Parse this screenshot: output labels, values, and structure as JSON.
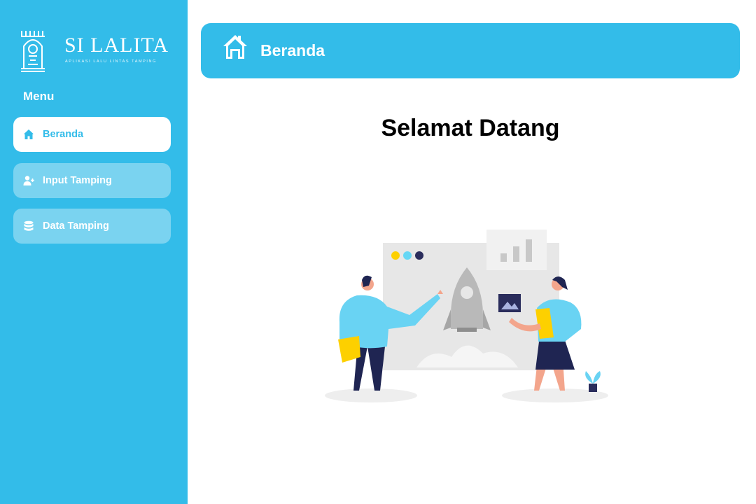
{
  "brand": {
    "name": "SI LALITA",
    "tagline": "APLIKASI LALU LINTAS TAMPING",
    "logo_icon": "gate-icon"
  },
  "sidebar": {
    "menu_heading": "Menu",
    "items": [
      {
        "label": "Beranda",
        "icon": "home-icon",
        "active": true
      },
      {
        "label": "Input Tamping",
        "icon": "user-plus-icon",
        "active": false
      },
      {
        "label": "Data Tamping",
        "icon": "database-icon",
        "active": false
      }
    ]
  },
  "header": {
    "title": "Beranda",
    "icon": "home-icon"
  },
  "main": {
    "welcome_text": "Selamat Datang",
    "illustration": "presentation-illustration"
  },
  "colors": {
    "primary": "#33bce9",
    "white": "#ffffff",
    "inactive_item_bg": "rgba(255,255,255,0.35)"
  }
}
